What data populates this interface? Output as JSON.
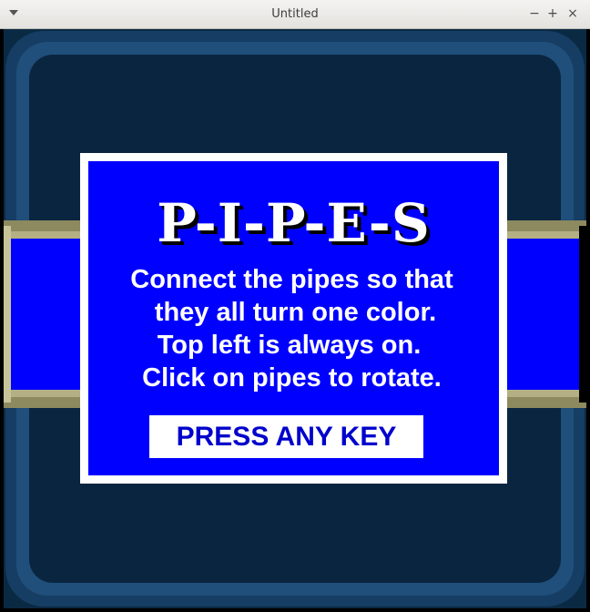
{
  "window": {
    "title": "Untitled",
    "minimize_label": "−",
    "maximize_label": "+",
    "close_label": "×"
  },
  "game": {
    "heading": "P-I-P-E-S",
    "instructions": [
      "Connect the pipes so that",
      "they all turn one color.",
      "Top left is always on.",
      "Click on pipes to rotate."
    ],
    "press_key_label": "PRESS ANY KEY"
  },
  "colors": {
    "dialog_bg": "#0000ff",
    "dialog_border": "#ffffff",
    "press_text": "#0000cc",
    "game_bg": "#0a2a44",
    "pipe_fill": "#0000ff",
    "pipe_edge": "#b4b083"
  }
}
